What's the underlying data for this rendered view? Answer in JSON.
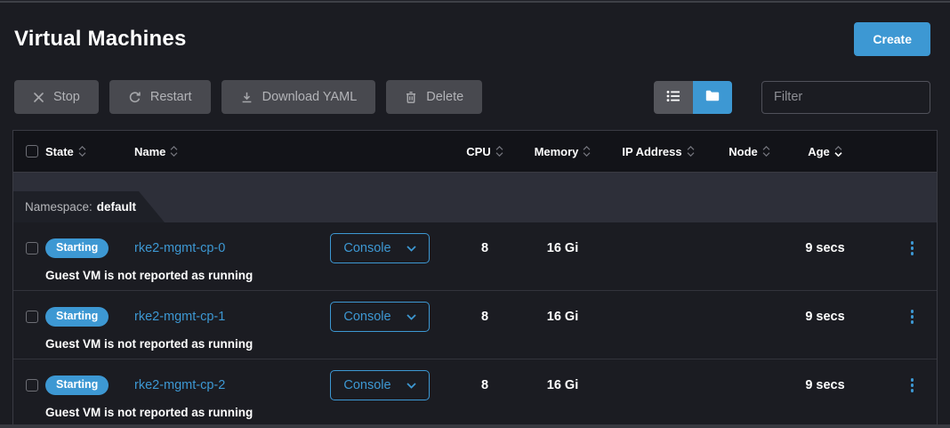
{
  "colors": {
    "accent_blue": "#3d98d3",
    "page_bg": "#1b1c22",
    "table_header_bg": "#121318",
    "group_bar_bg": "#2d2f39",
    "group_tab_bg": "#1e2027",
    "disabled_button_bg": "#48494f",
    "border": "#3a3b43"
  },
  "page": {
    "title": "Virtual Machines"
  },
  "actions": {
    "create_label": "Create",
    "bulk_buttons": [
      {
        "label": "Stop",
        "icon": "x-icon"
      },
      {
        "label": "Restart",
        "icon": "refresh-icon"
      },
      {
        "label": "Download YAML",
        "icon": "download-icon"
      },
      {
        "label": "Delete",
        "icon": "trash-icon"
      }
    ]
  },
  "view_toggle": {
    "options": [
      "list-view",
      "grouped-view"
    ],
    "active": "grouped-view"
  },
  "filter": {
    "placeholder": "Filter"
  },
  "table": {
    "columns": [
      {
        "label": "State"
      },
      {
        "label": "Name"
      },
      {
        "label": "CPU"
      },
      {
        "label": "Memory"
      },
      {
        "label": "IP Address"
      },
      {
        "label": "Node"
      },
      {
        "label": "Age"
      }
    ],
    "sort": {
      "column": "Age",
      "direction": "desc"
    },
    "group": {
      "label": "Namespace:",
      "value": "default"
    },
    "rows": [
      {
        "state": "Starting",
        "name": "rke2-mgmt-cp-0",
        "console_label": "Console",
        "cpu": "8",
        "memory": "16 Gi",
        "ip_address": "",
        "node": "",
        "age": "9 secs",
        "message": "Guest VM is not reported as running"
      },
      {
        "state": "Starting",
        "name": "rke2-mgmt-cp-1",
        "console_label": "Console",
        "cpu": "8",
        "memory": "16 Gi",
        "ip_address": "",
        "node": "",
        "age": "9 secs",
        "message": "Guest VM is not reported as running"
      },
      {
        "state": "Starting",
        "name": "rke2-mgmt-cp-2",
        "console_label": "Console",
        "cpu": "8",
        "memory": "16 Gi",
        "ip_address": "",
        "node": "",
        "age": "9 secs",
        "message": "Guest VM is not reported as running"
      }
    ]
  }
}
